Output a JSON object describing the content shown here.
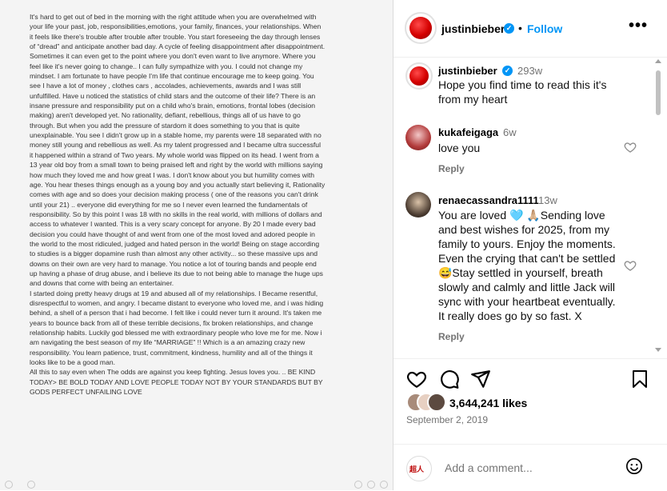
{
  "post": {
    "note_text": "It's hard to get out of bed in the morning with the right attitude when you are overwhelmed with your life your past, job, responsibilities,emotions, your family, finances, your relationships. When it feels like there's trouble  after trouble after trouble. You start foreseeing the day through lenses of “dread” and anticipate another bad day. A cycle of feeling disappointment after disappointment. Sometimes it can even get to the point where you don't even want to live anymore. Where you feel like it's never going to change.. I can fully sympathize with you. I could not change my mindset. I am fortunate to have people I'm life that continue encourage me to keep going. You see I have a lot of money , clothes cars , accolades, achievements, awards and I was still unfulfilled. Have u noticed the statistics of child stars and the outcome of their life? There is an insane pressure and responsibility put on a child who's brain, emotions, frontal lobes (decision making) aren't developed yet.  No rationality, defiant, rebellious, things all of us have to go through. But when you add the pressure of stardom it does something to you that is quite unexplainable. You see I didn't grow up in a stable home, my parents were 18 separated  with no money still young and rebellious as well. As my talent progressed and I became ultra successful it happened within a strand of Two years. My whole world was flipped on its head. I went from a 13 year old boy from a small town to being praised left and right by the world with millions saying how much they loved me and how great I was. I don't know about you but humility comes with age. You hear theses things enough as a young boy and you actually start believing it, Rationality comes with age and so does your decision making process ( one of the reasons you can't drink until your 21) .. everyone did everything for me so I never even learned the fundamentals of responsibility. So  by this point I was 18 with no skills in the real world, with millions of dollars and access to whatever I wanted. This is a very scary concept for anyone.  By 20 I made every bad decision you could have thought of and went from one of the most loved and adored people in the world to the most ridiculed, judged and hated person in the world! Being on stage according to studies is a bigger dopamine rush than almost any other activity... so these massive ups and downs on their own are very hard to manage. You notice a lot of touring bands and people end up having a phase of drug abuse, and i believe its due to not being able to manage the huge ups and downs that come with being an entertainer.\nI started doing pretty heavy drugs at 19 and abused all of my relationships. I Became resentful, disrespectful to women, and angry. I became distant to everyone who loved me, and i was hiding behind, a shell of a person that i had become. I felt like i could never turn it around. It's taken me years to bounce back from all of these terrible decisions, fix broken relationships, and change relationship habits. Luckily god blessed me with extraordinary people who love me for me. Now i am navigating the best season of my life “MARRIAGE” !! Which is a an amazing crazy new responsibility. You learn patience, trust, commitment, kindness, humility and all of the things it looks like to be a good man.\nAll this to say even when The odds are against you keep fighting. Jesus loves you. .. BE KIND TODAY> BE BOLD TODAY AND LOVE PEOPLE TODAY NOT BY YOUR STANDARDS BUT BY GODS PERFECT UNFAILING LOVE"
  },
  "header": {
    "username": "justinbieber",
    "separator": "•",
    "follow_label": "Follow",
    "more_label": "•••"
  },
  "comments": [
    {
      "username": "justinbieber",
      "time": "293w",
      "text": "Hope you find time to read this it's from my heart",
      "verified": true
    },
    {
      "username": "kukafeigaga",
      "time": "6w",
      "text": "love you",
      "reply_label": "Reply"
    },
    {
      "username": "renaecassandra1111",
      "time": "13w",
      "text": "You are loved 🩵 🙏🏼Sending love and best wishes for 2025, from my family to yours. Enjoy the moments. Even the crying that can't be settled 😅Stay settled in yourself, breath slowly and calmly and little Jack will sync with your heartbeat eventually. It really does go by so fast. X",
      "reply_label": "Reply"
    }
  ],
  "actions": {
    "likes": "3,644,241 likes",
    "date": "September 2, 2019"
  },
  "add_comment": {
    "placeholder": "Add a comment..."
  },
  "colors": {
    "accent": "#0095f6",
    "muted": "#737373",
    "border": "#efefef"
  },
  "icons": [
    "more-icon",
    "verified-icon",
    "heart-icon",
    "comment-icon",
    "share-icon",
    "save-icon",
    "emoji-icon"
  ]
}
